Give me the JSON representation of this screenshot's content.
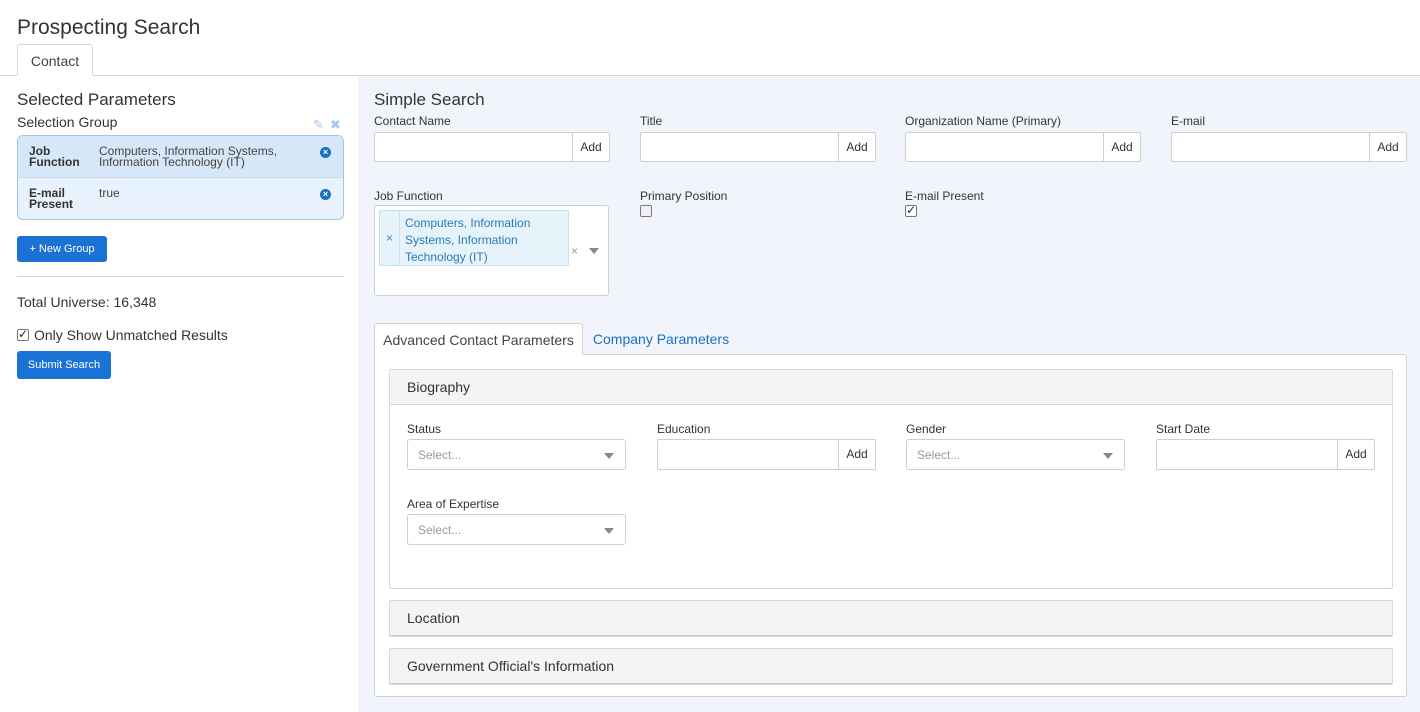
{
  "page": {
    "title": "Prospecting Search"
  },
  "top_tabs": [
    {
      "label": "Contact",
      "active": true
    }
  ],
  "left": {
    "selected_title": "Selected Parameters",
    "selection_group_label": "Selection Group",
    "actions": {
      "edit_icon": "edit-icon",
      "delete_icon": "close-icon"
    },
    "params": [
      {
        "key": "Job Function",
        "value": "Computers, Information Systems, Information Technology (IT)"
      },
      {
        "key": "E-mail Present",
        "value": "true"
      }
    ],
    "new_group_label": "+ New Group",
    "total_universe": "Total Universe: 16,348",
    "only_unmatched_label": "Only Show Unmatched Results",
    "only_unmatched_checked": true,
    "submit_label": "Submit Search"
  },
  "simple": {
    "title": "Simple Search",
    "add_label": "Add",
    "fields": {
      "contact_name": {
        "label": "Contact Name",
        "value": ""
      },
      "title": {
        "label": "Title",
        "value": ""
      },
      "organization": {
        "label": "Organization Name (Primary)",
        "value": ""
      },
      "email": {
        "label": "E-mail",
        "value": ""
      }
    },
    "job_function": {
      "label": "Job Function",
      "tag": "Computers, Information Systems, Information Technology (IT)"
    },
    "primary_position": {
      "label": "Primary Position",
      "checked": false
    },
    "email_present": {
      "label": "E-mail Present",
      "checked": true
    }
  },
  "advanced": {
    "tabs": [
      {
        "label": "Advanced Contact Parameters",
        "active": true
      },
      {
        "label": "Company Parameters",
        "active": false
      }
    ],
    "biography": {
      "title": "Biography",
      "status": {
        "label": "Status",
        "placeholder": "Select..."
      },
      "education": {
        "label": "Education",
        "add": "Add"
      },
      "gender": {
        "label": "Gender",
        "placeholder": "Select..."
      },
      "start_date": {
        "label": "Start Date",
        "add": "Add"
      },
      "area_of_expertise": {
        "label": "Area of Expertise",
        "placeholder": "Select..."
      }
    },
    "location_title": "Location",
    "government_title": "Government Official's Information"
  }
}
